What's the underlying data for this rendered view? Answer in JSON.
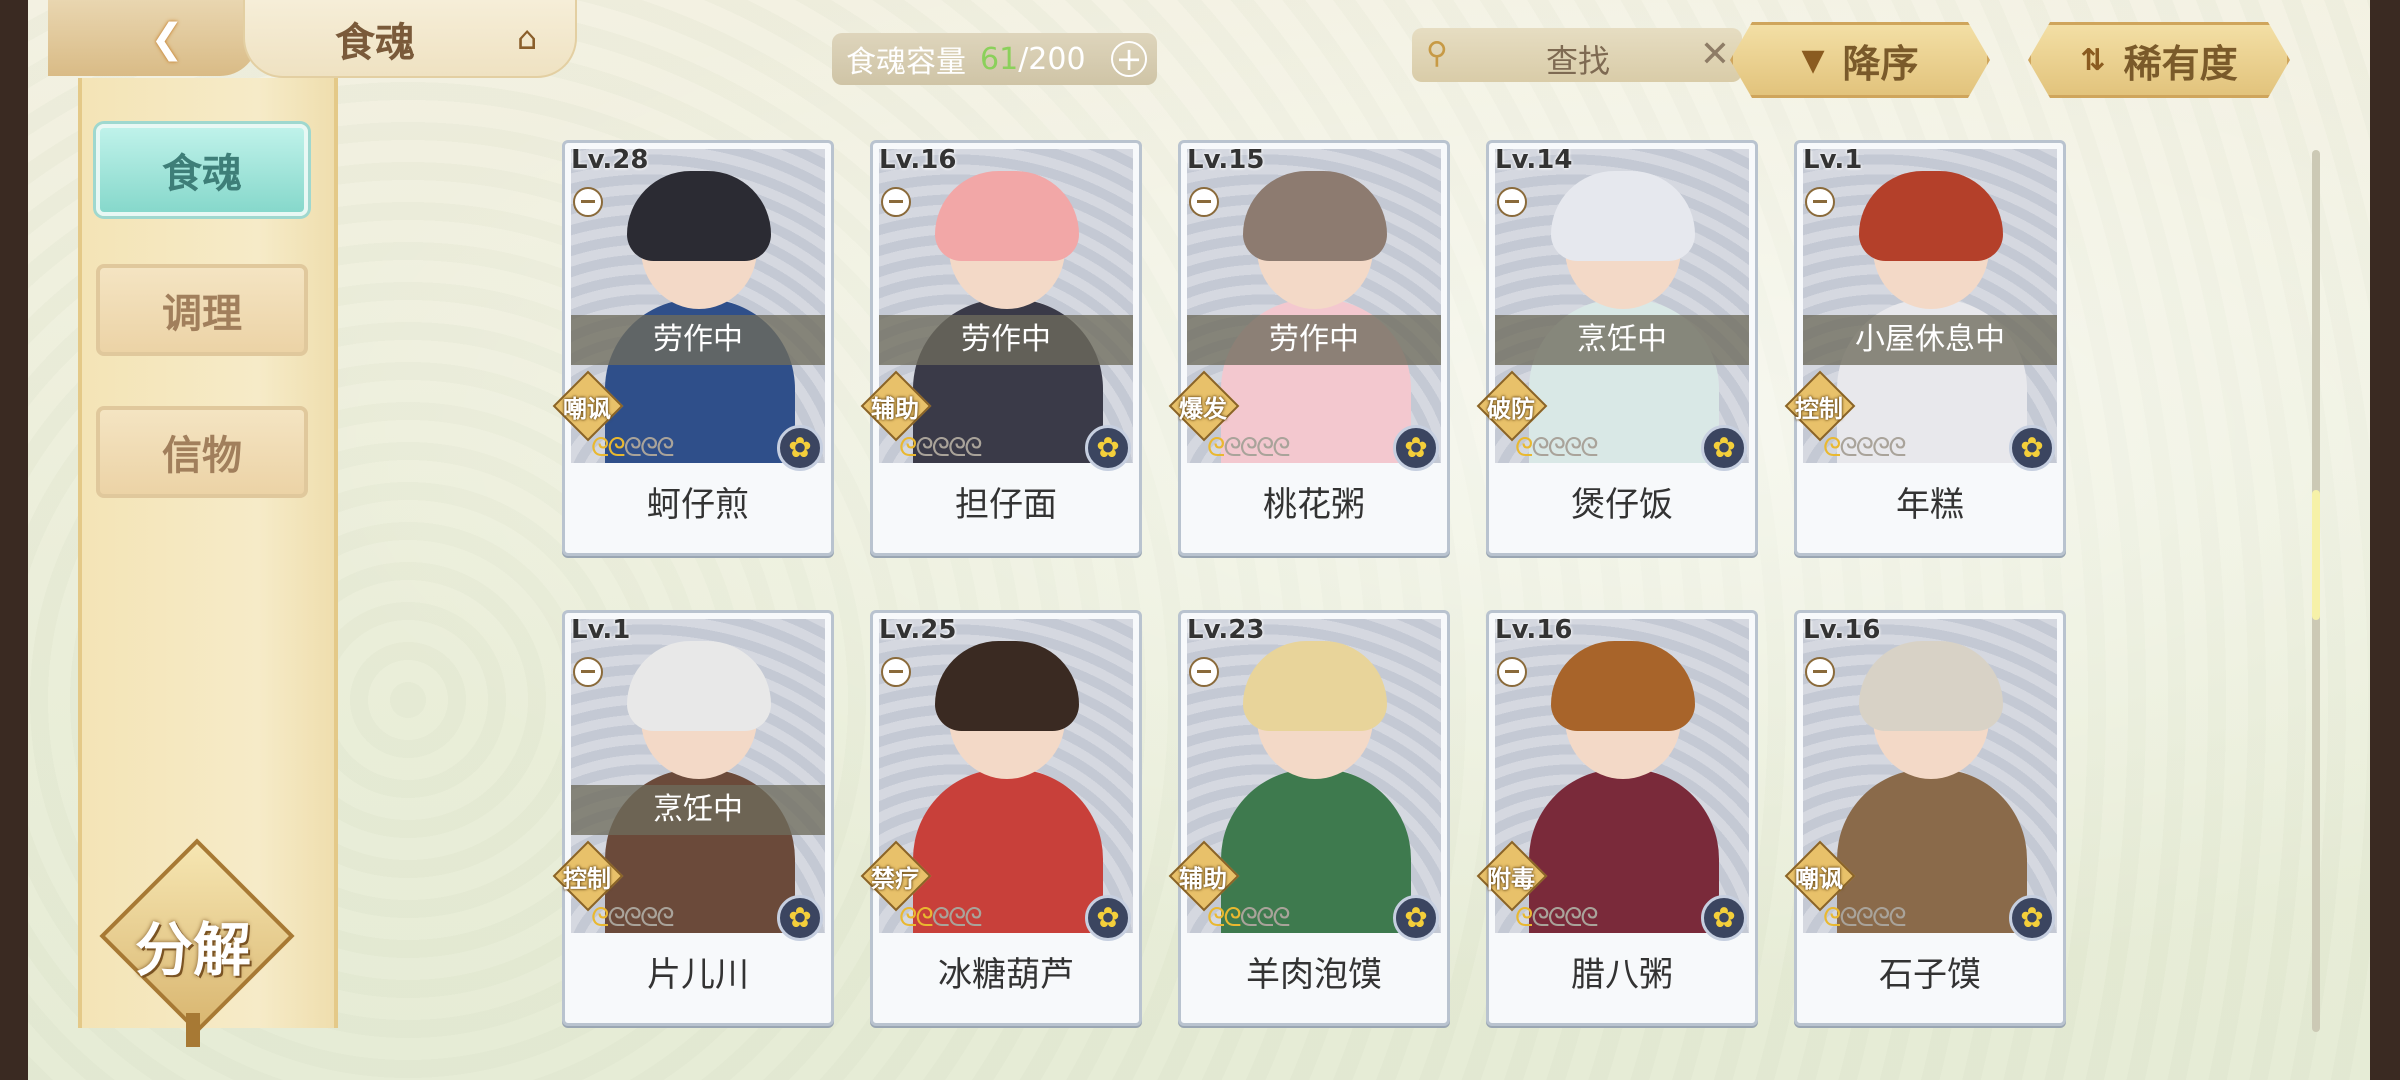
{
  "header": {
    "title": "食魂",
    "capacity_label": "食魂容量",
    "capacity_current": "61",
    "capacity_max": "/200",
    "search_label": "查找",
    "sort_order_label": "降序",
    "sort_field_label": "稀有度"
  },
  "sidebar": {
    "items": [
      {
        "label": "食魂",
        "active": true
      },
      {
        "label": "调理",
        "active": false
      },
      {
        "label": "信物",
        "active": false
      }
    ],
    "decompose_label": "分解"
  },
  "colors": {
    "accent_active": "#86d8cb",
    "gold": "#e2c37c",
    "capacity_green": "#8bd05b"
  },
  "cards": [
    {
      "level": "Lv.28",
      "name": "蚵仔煎",
      "status": "劳作中",
      "role": "嘲讽",
      "stars": 2,
      "hair": "#2b2b33",
      "body": "#2f4f8a"
    },
    {
      "level": "Lv.16",
      "name": "担仔面",
      "status": "劳作中",
      "role": "辅助",
      "stars": 1,
      "hair": "#f2a7a7",
      "body": "#3a3a48"
    },
    {
      "level": "Lv.15",
      "name": "桃花粥",
      "status": "劳作中",
      "role": "爆发",
      "stars": 1,
      "hair": "#8d7b70",
      "body": "#f3c8cf"
    },
    {
      "level": "Lv.14",
      "name": "煲仔饭",
      "status": "烹饪中",
      "role": "破防",
      "stars": 1,
      "hair": "#e6e8ee",
      "body": "#d9e8e6"
    },
    {
      "level": "Lv.1",
      "name": "年糕",
      "status": "小屋休息中",
      "role": "控制",
      "stars": 1,
      "hair": "#b4402a",
      "body": "#e8e8ec"
    },
    {
      "level": "Lv.1",
      "name": "片儿川",
      "status": "烹饪中",
      "role": "控制",
      "stars": 1,
      "hair": "#e8e8e8",
      "body": "#6b4a3a"
    },
    {
      "level": "Lv.25",
      "name": "冰糖葫芦",
      "status": "",
      "role": "禁疗",
      "stars": 2,
      "hair": "#3a2a22",
      "body": "#c8403a"
    },
    {
      "level": "Lv.23",
      "name": "羊肉泡馍",
      "status": "",
      "role": "辅助",
      "stars": 2,
      "hair": "#e8d49a",
      "body": "#3e7a4e"
    },
    {
      "level": "Lv.16",
      "name": "腊八粥",
      "status": "",
      "role": "附毒",
      "stars": 1,
      "hair": "#a8642a",
      "body": "#7a2a3a"
    },
    {
      "level": "Lv.16",
      "name": "石子馍",
      "status": "",
      "role": "嘲讽",
      "stars": 1,
      "hair": "#d8d2c6",
      "body": "#8a6a4a"
    }
  ]
}
